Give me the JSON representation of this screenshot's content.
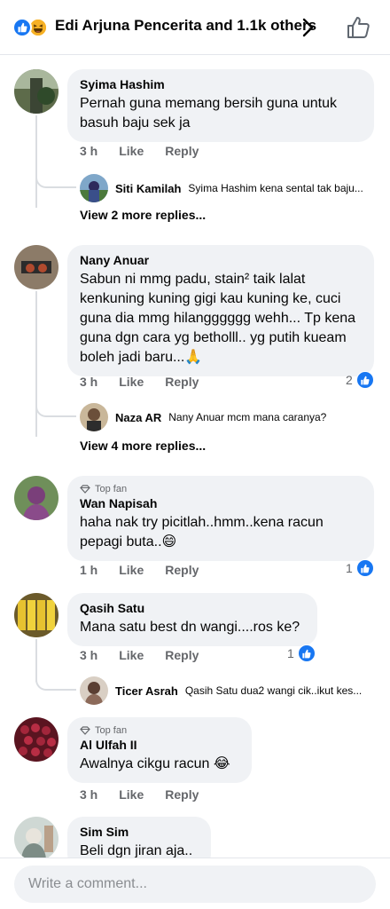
{
  "header": {
    "title": "Edi Arjuna Pencerita and 1.1k others"
  },
  "comments": [
    {
      "author": "Syima Hashim",
      "text": "Pernah guna memang bersih guna untuk basuh baju sek ja",
      "time": "3 h",
      "like": "Like",
      "reply": "Reply",
      "preview_reply": {
        "author": "Siti Kamilah",
        "text": "Syima Hashim kena sental tak baju..."
      },
      "more_replies": "View 2 more replies..."
    },
    {
      "author": "Nany Anuar",
      "text": "Sabun ni mmg padu, stain² taik lalat kenkuning kuning gigi kau kuning ke, cuci guna dia mmg hilangggggg wehh... Tp kena guna dgn cara yg betholll.. yg putih kueam boleh jadi baru...🙏",
      "time": "3 h",
      "like": "Like",
      "reply": "Reply",
      "reactions": "2",
      "preview_reply": {
        "author": "Naza AR",
        "text": "Nany Anuar mcm mana caranya?"
      },
      "more_replies": "View 4 more replies..."
    },
    {
      "badge": "Top fan",
      "author": "Wan Napisah",
      "text": "haha nak try picitlah..hmm..kena racun pepagi buta..😄",
      "time": "1 h",
      "like": "Like",
      "reply": "Reply",
      "reactions": "1"
    },
    {
      "author": "Qasih Satu",
      "text": "Mana satu best dn wangi....ros ke?",
      "time": "3 h",
      "like": "Like",
      "reply": "Reply",
      "reactions": "1",
      "preview_reply": {
        "author": "Ticer Asrah",
        "text": "Qasih Satu dua2 wangi cik..ikut kes..."
      }
    },
    {
      "badge": "Top fan",
      "author": "Al Ulfah II",
      "text": "Awalnya cikgu racun 😂",
      "time": "3 h",
      "like": "Like",
      "reply": "Reply"
    },
    {
      "author": "Sim Sim",
      "text": "Beli dgn jiran aja.."
    }
  ],
  "footer": {
    "placeholder": "Write a comment..."
  },
  "icons": {
    "like_reaction": "like-reaction-icon",
    "haha_reaction": "haha-reaction-icon",
    "chevron": "chevron-right-icon",
    "thumb": "thumbs-up-outline-icon",
    "diamond": "top-fan-diamond-icon"
  },
  "colors": {
    "accent": "#1877f2",
    "bubble": "#f0f2f5",
    "muted": "#65676b"
  }
}
